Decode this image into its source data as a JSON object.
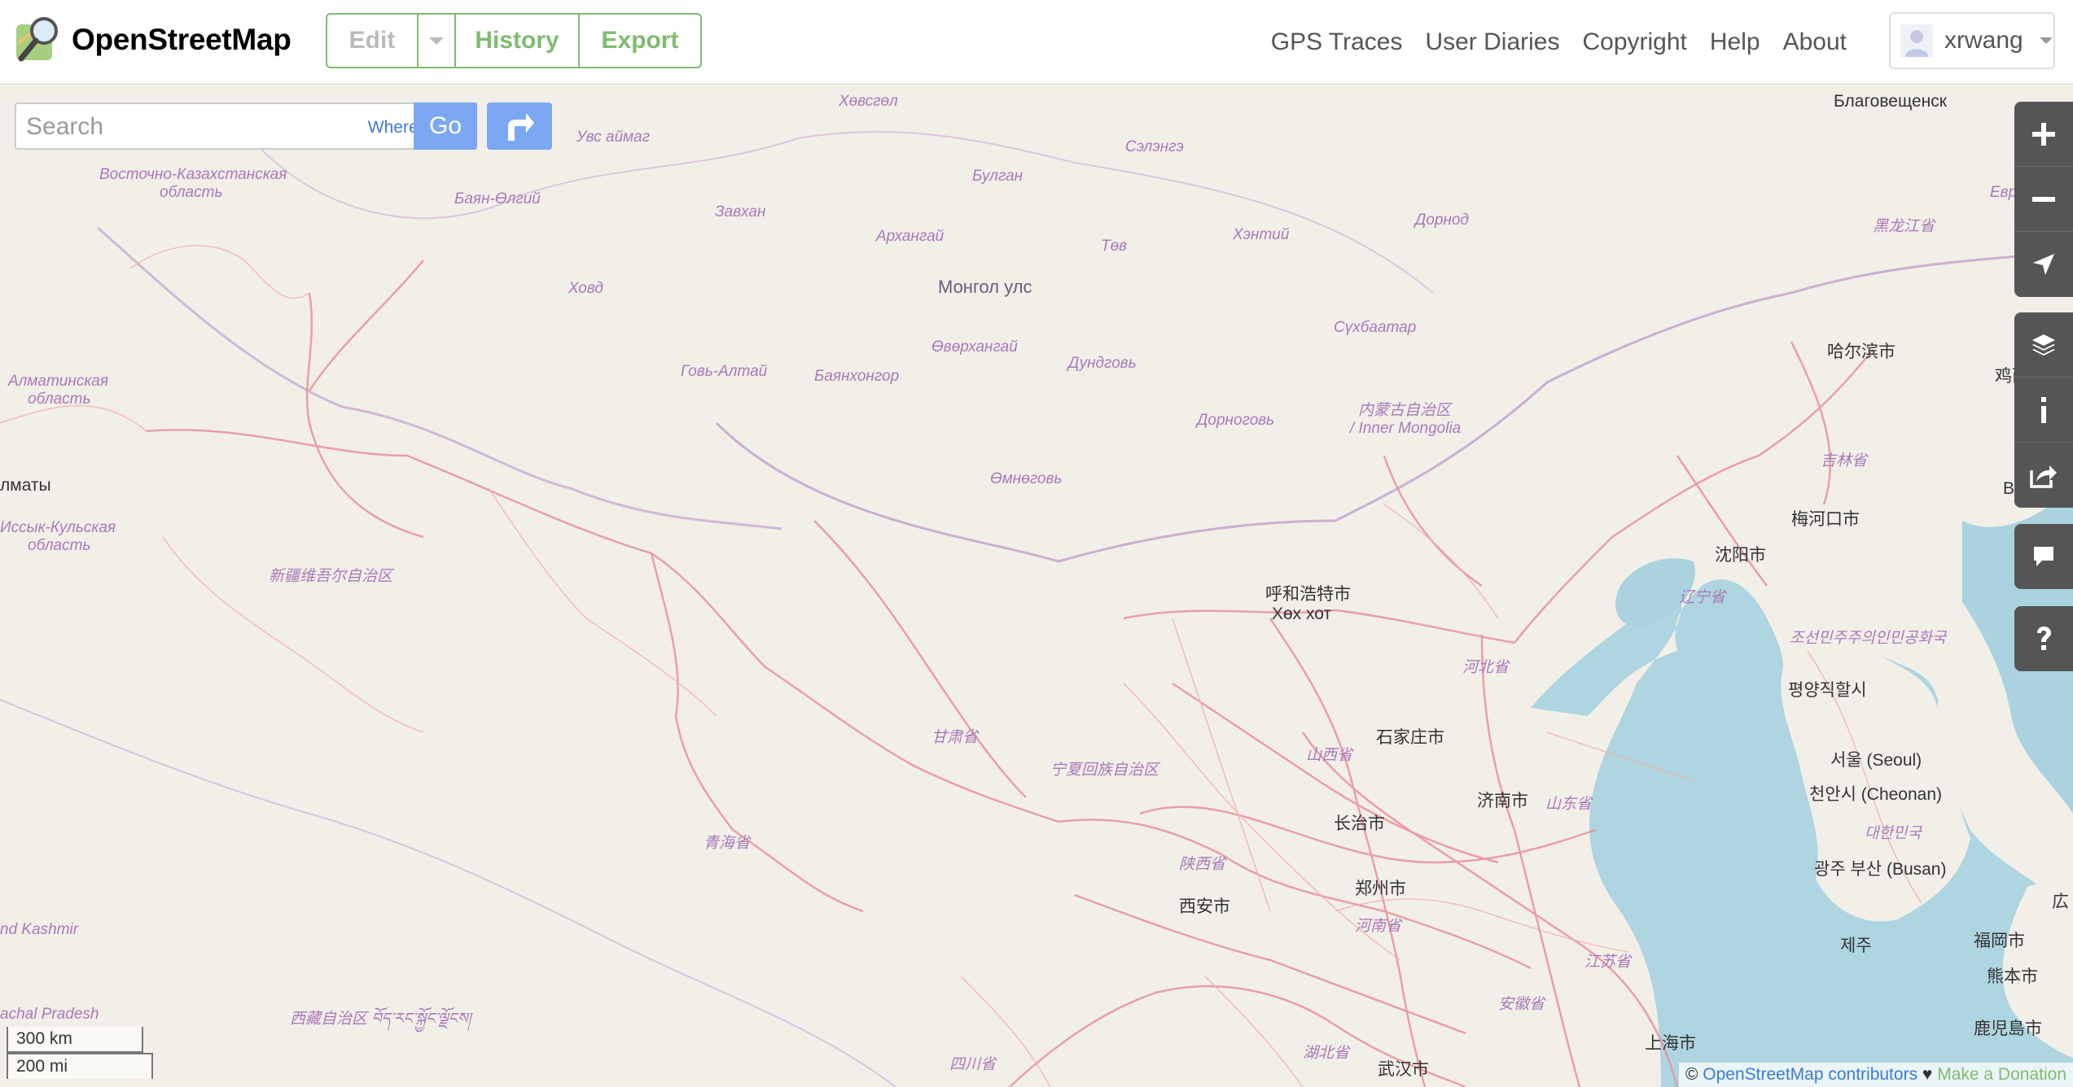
{
  "header": {
    "app_title": "OpenStreetMap",
    "tabs": {
      "edit": "Edit",
      "history": "History",
      "export": "Export"
    },
    "nav": [
      "GPS Traces",
      "User Diaries",
      "Copyright",
      "Help",
      "About"
    ],
    "user": {
      "name": "xrwang"
    }
  },
  "search": {
    "placeholder": "Search",
    "where_am_i": "Where am I?",
    "go": "Go"
  },
  "scale": {
    "km": "300 km",
    "mi": "200 mi"
  },
  "attribution": {
    "prefix": "©",
    "contributors": "OpenStreetMap contributors",
    "heart": "♥",
    "donate": "Make a Donation"
  },
  "map_labels": {
    "khovsgol": "Хөвсгөл",
    "uvs": "Увс аймаг",
    "selenge": "Сэлэнгэ",
    "bulgan": "Булган",
    "east_kaz_1": "Восточно-Казахстанская",
    "east_kaz_2": "область",
    "bayan_olgii": "Баян-Өлгий",
    "zavkhan": "Завхан",
    "arkhangai": "Архангай",
    "dornod": "Дорнод",
    "tov": "Төв",
    "khentii": "Хэнтий",
    "khovd": "Ховд",
    "mongolia": "Монгол улс",
    "ovorkhangai": "Өвөрхангай",
    "sukhbaatar": "Сүхбаатар",
    "almaty_1": "Алматинская",
    "almaty_2": "область",
    "govi_altai": "Говь-Алтай",
    "bayankhongor": "Баянхонгор",
    "dundgovi": "Дундговь",
    "inner_mongolia_1": "内蒙古自治区",
    "inner_mongolia_2": "/ Inner Mongolia",
    "dornogovi": "Дорноговь",
    "almaty_city": "лматы",
    "omnogovi": "Өмнөговь",
    "issyk_1": "Иссык-Кульская",
    "issyk_2": "область",
    "xinjiang": "新疆维吾尔自治区",
    "hohhot_1": "呼和浩特市",
    "hohhot_2": "Хөх хот",
    "gansu": "甘肃省",
    "ningxia": "宁夏回族自治区",
    "shanxi": "山西省",
    "shijiazhuang": "石家庄市",
    "qinghai": "青海省",
    "jinan": "济南市",
    "shandong": "山东省",
    "changzhi": "长治市",
    "shaanxi": "陕西省",
    "xian": "西安市",
    "zhengzhou": "郑州市",
    "henan": "河南省",
    "kashmir": "nd Kashmir",
    "arunachal": "achal Pradesh",
    "tibet": "西藏自治区 བོད་རང་སྐྱོང་ལྗོངས།",
    "sichuan": "四川省",
    "hubei": "湖北省",
    "wuhan": "武汉市",
    "shanghai": "上海市",
    "jiangsu": "江苏省",
    "anhui": "安徽省",
    "blagoveshchensk": "Благовещенск",
    "heilongjiang": "黑龙江省",
    "evrei": "Еврей",
    "harbin": "哈尔滨市",
    "jixi": "鸡西市",
    "jilin": "吉林省",
    "vladivostok": "Владивос",
    "meihekou": "梅河口市",
    "shenyang": "沈阳市",
    "liaoning": "辽宁省",
    "dprk": "조선민주주의인민공화국",
    "hebei": "河北省",
    "pyongyang": "평양직할시",
    "seoul": "서울 (Seoul)",
    "cheonan": "천안시 (Cheonan)",
    "korea": "대한민국",
    "gwangju_busan": "광주    부산 (Busan)",
    "jeju": "제주",
    "fukuoka": "福岡市",
    "kumamoto": "熊本市",
    "kagoshima": "鹿児島市",
    "hiroshima": "広"
  }
}
